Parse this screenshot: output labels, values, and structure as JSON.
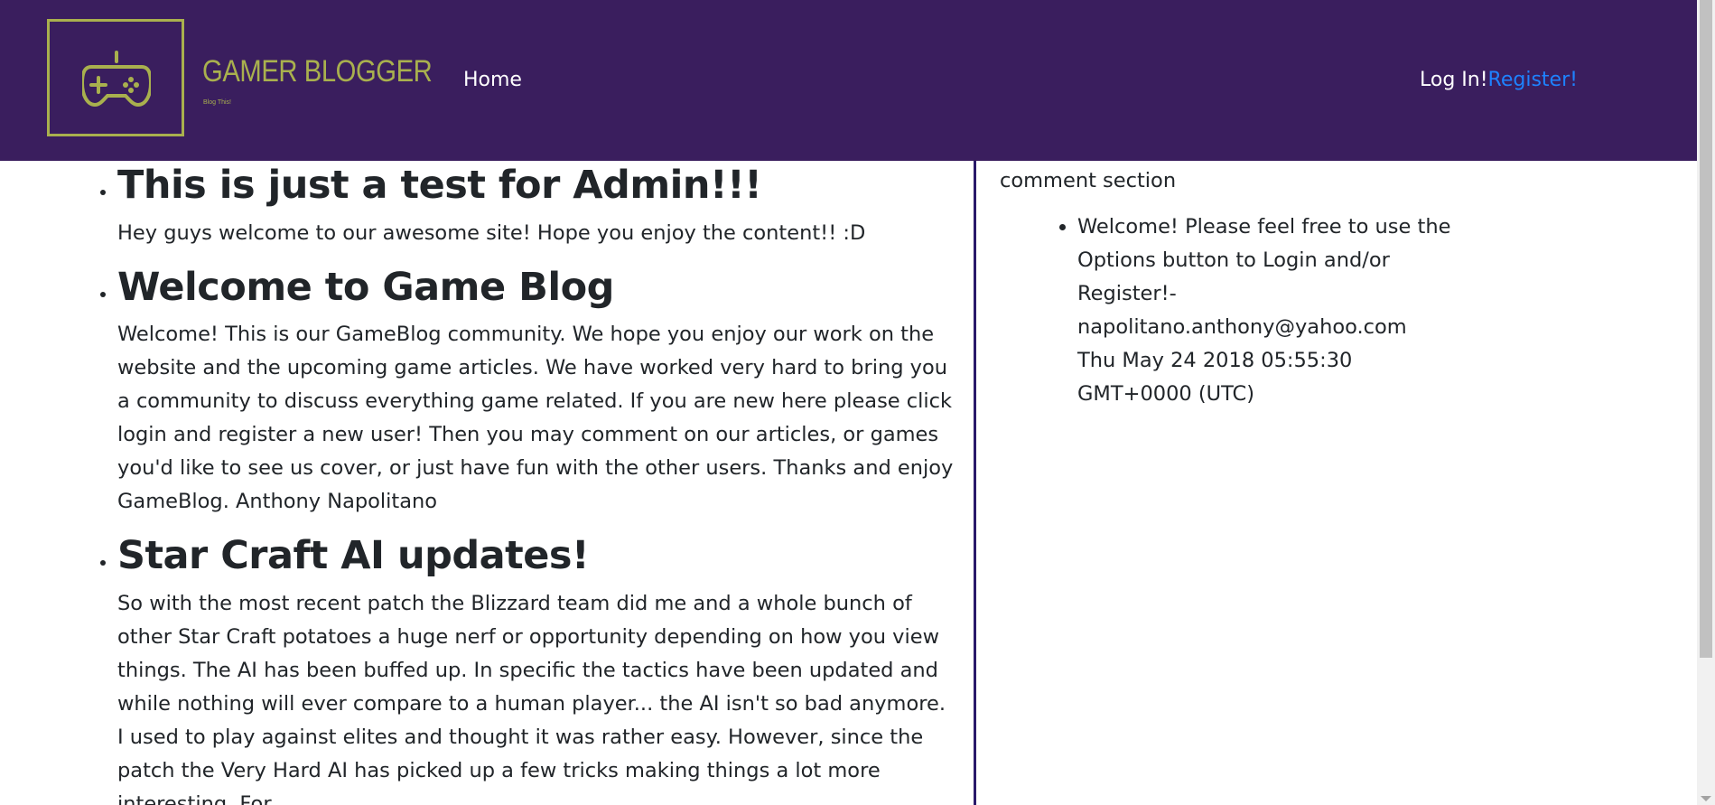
{
  "brand": {
    "title": "GAMER BLOGGER",
    "tagline": "Blog This!",
    "logo_icon": "gamepad-icon",
    "accent_color": "#a9b04e",
    "nav_bg_color": "#3a1e5e"
  },
  "nav": {
    "home_label": "Home",
    "login_label": "Log In!",
    "register_label": "Register!"
  },
  "posts": [
    {
      "title": "This is just a test for Admin!!!",
      "body": "Hey guys welcome to our awesome site! Hope you enjoy the content!! :D"
    },
    {
      "title": "Welcome to Game Blog",
      "body": "Welcome! This is our GameBlog community. We hope you enjoy our work on the website and the upcoming game articles. We have worked very hard to bring you a community to discuss everything game related. If you are new here please click login and register a new user! Then you may comment on our articles, or games you'd like to see us cover, or just have fun with the other users. Thanks and enjoy GameBlog. Anthony Napolitano"
    },
    {
      "title": "Star Craft AI updates!",
      "body": "So with the most recent patch the Blizzard team did me and a whole bunch of other Star Craft potatoes a huge nerf or opportunity depending on how you view things. The AI has been buffed up. In specific the tactics have been updated and while nothing will ever compare to a human player... the AI isn't so bad anymore. I used to play against elites and thought it was rather easy. However, since the patch the Very Hard AI has picked up a few tricks making things a lot more interesting. For"
    }
  ],
  "comments": {
    "heading": "comment section",
    "items": [
      {
        "text": "Welcome! Please feel free to use the Options button to Login and/or Register!-",
        "author": "napolitano.anthony@yahoo.com",
        "timestamp": "Thu May 24 2018 05:55:30 GMT+0000 (UTC)"
      }
    ]
  }
}
